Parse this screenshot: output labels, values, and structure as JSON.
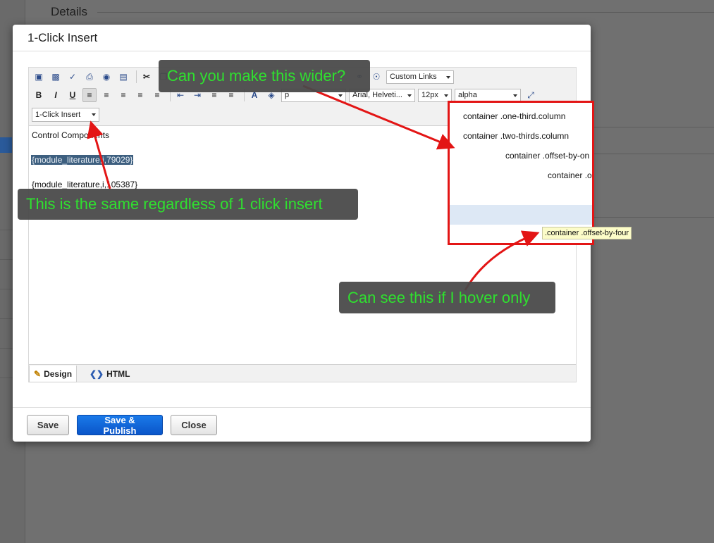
{
  "background": {
    "section_title": "Details"
  },
  "modal": {
    "title": "1-Click Insert",
    "toolbar": {
      "custom_links": "Custom Links",
      "paragraph": "p",
      "font_family": "Arial, Helveti...",
      "font_size": "12px",
      "style": "alpha",
      "one_click_insert": "1-Click Insert"
    },
    "content_lines": [
      "Control Components",
      "{module_literature,i,79029}",
      "{module_literature,i,105387}"
    ],
    "tabs": {
      "design": "Design",
      "html": "HTML"
    },
    "footer": {
      "save": "Save",
      "save_publish": "Save & Publish",
      "close": "Close"
    }
  },
  "dropdown_list": {
    "items": [
      "container .one-third.column",
      "container .two-thirds.column",
      "container .offset-by-on",
      "container .o"
    ],
    "tooltip": ".container .offset-by-four"
  },
  "annotations": {
    "wider": "Can you make this wider?",
    "same": "This is the same regardless of 1 click insert",
    "hover": "Can see this if I hover only"
  },
  "colors": {
    "annotation_text": "#2fe02f",
    "arrow": "#e31515",
    "primary_button": "#0a62d8"
  }
}
